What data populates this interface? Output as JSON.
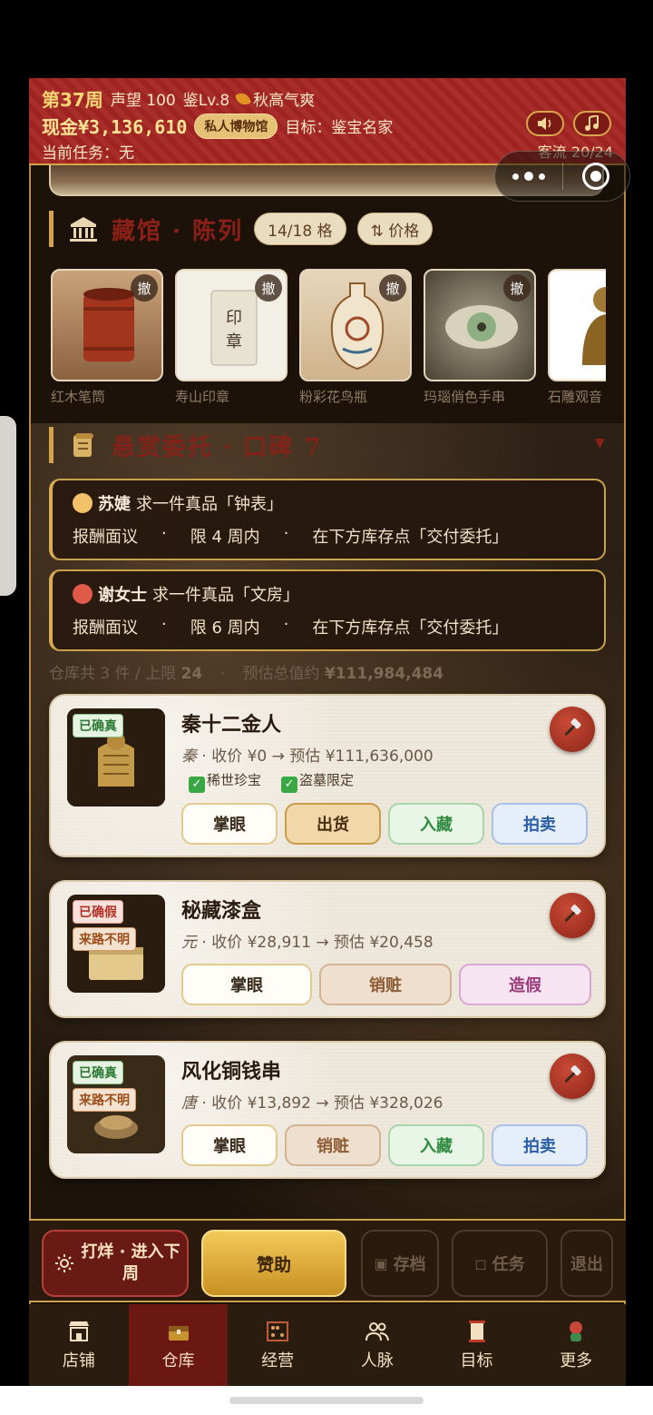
{
  "header": {
    "week": "第37周",
    "reputation": "声望 100",
    "level": "鉴Lv.8",
    "season": "秋高气爽",
    "cash": "现金¥3,136,610",
    "museum_badge": "私人博物馆",
    "goal": "目标：鉴宝名家",
    "task": "当前任务：无",
    "visitors": "客流 20/24",
    "sound_icon": "speaker-icon",
    "music_icon": "music-note-icon"
  },
  "exhibit_section": {
    "title": "藏馆 · 陈列",
    "slots": "14/18 格",
    "sort": "⇅ 价格",
    "remove_label": "撤",
    "items": [
      {
        "name": "红木笔筒"
      },
      {
        "name": "寿山印章"
      },
      {
        "name": "粉彩花鸟瓶"
      },
      {
        "name": "玛瑙俏色手串"
      },
      {
        "name": "石雕观音"
      }
    ]
  },
  "commission_section": {
    "title": "悬赏委托 · 口碑 7",
    "commissions": [
      {
        "who": "苏婕",
        "request": "求一件真品「钟表」",
        "reward": "报酬面议",
        "deadline": "限 4 周内",
        "hint": "在下方库存点「交付委托」"
      },
      {
        "who": "谢女士",
        "request": "求一件真品「文房」",
        "reward": "报酬面议",
        "deadline": "限 6 周内",
        "hint": "在下方库存点「交付委托」"
      }
    ]
  },
  "storage": {
    "count_text": "仓库共 3 件 / 上限",
    "limit": "24",
    "sep": "·",
    "total_text": "预估总值约",
    "total_value": "¥111,984,484"
  },
  "items": [
    {
      "title": "秦十二金人",
      "dynasty": "秦",
      "meta": " · 收价 ¥0 → 预估 ¥111,636,000",
      "badges": [
        "已确真"
      ],
      "tags": [
        "稀世珍宝",
        "盗墓限定"
      ],
      "buttons": [
        "掌眼",
        "出货",
        "入藏",
        "拍卖"
      ]
    },
    {
      "title": "秘藏漆盒",
      "dynasty": "元",
      "meta": " · 收价 ¥28,911 → 预估 ¥20,458",
      "badges": [
        "已确假",
        "来路不明"
      ],
      "buttons": [
        "掌眼",
        "销赃",
        "造假"
      ]
    },
    {
      "title": "风化铜钱串",
      "dynasty": "唐",
      "meta": " · 收价 ¥13,892 → 预估 ¥328,026",
      "badges": [
        "已确真",
        "来路不明"
      ],
      "buttons": [
        "掌眼",
        "销赃",
        "入藏",
        "拍卖"
      ]
    }
  ],
  "action_bar": {
    "next_week": "打烊 · 进入下周",
    "sponsor": "赞助",
    "save": "存档",
    "tasks": "任务",
    "exit": "退出"
  },
  "nav": [
    {
      "label": "店铺",
      "icon": "shop-icon"
    },
    {
      "label": "仓库",
      "icon": "warehouse-chest-icon"
    },
    {
      "label": "经营",
      "icon": "abacus-icon"
    },
    {
      "label": "人脉",
      "icon": "people-icon"
    },
    {
      "label": "目标",
      "icon": "scroll-goal-icon"
    },
    {
      "label": "更多",
      "icon": "more-icon"
    }
  ],
  "colors": {
    "header_red": "#a52522",
    "gold": "#d6a546",
    "card_bg": "#efe8dc"
  }
}
